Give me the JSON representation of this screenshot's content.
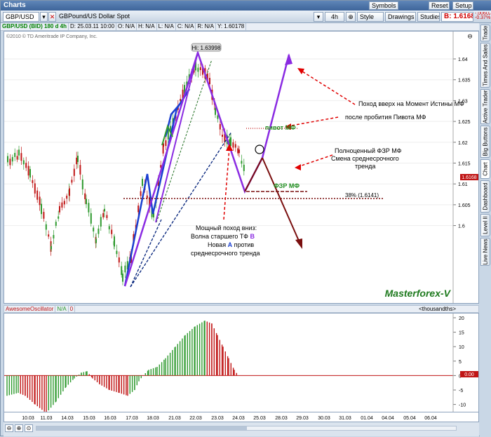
{
  "window": {
    "title": "Charts"
  },
  "toolbar": {
    "symbol": "GBP/USD",
    "description": "GBPound/US Dollar Spot",
    "timeframe": "4h",
    "style_label": "Style",
    "drawings_label": "Drawings",
    "studies_label": "Studies",
    "symbols_label": "Symbols",
    "reset_label": "Reset",
    "setup_label": "Setup",
    "bid_price": "B: 1.6168",
    "change_1": "-.00602",
    "change_2": "-0.37%"
  },
  "infobar": {
    "symbol_line": "GBP/USD (BID) 180 d 4h",
    "date": "D: 25.03.11 10:00",
    "open": "O: N/A",
    "high": "H: N/A",
    "low": "L: N/A",
    "close": "C: N/A",
    "range": "R: N/A",
    "y": "Y: 1.60178"
  },
  "chart": {
    "copyright": "©2010 © TD Ameritrade IP Company, Inc.",
    "hi_label": "Hi: 1.63998",
    "watermark": "Masterforex-V",
    "price_ticks": [
      "1.64",
      "1.635",
      "1.63",
      "1.625",
      "1.62",
      "1.615",
      "1.61",
      "1.605",
      "1.6"
    ],
    "price_values": [
      1.64,
      1.635,
      1.63,
      1.625,
      1.62,
      1.615,
      1.61,
      1.605,
      1.6
    ],
    "current_price_tag": "1.6168",
    "annotations": {
      "up_move": "Поход вверх на Момент Истины МФ",
      "after_pivot": "после пробития Пивота МФ",
      "pivot": "пивот МФ",
      "fzr_complete_1": "Полноценный ФЗР МФ",
      "fzr_complete_2": "Смена среднесрочного",
      "fzr_complete_3": "тренда",
      "fzr": "ФЗР МФ",
      "fib38": "38% (1.6141)",
      "down_1": "Мощный поход вниз:",
      "down_2a": "Волна старшего ТФ ",
      "down_2b": "B",
      "down_3a": "Новая ",
      "down_3b": "A",
      "down_3c": " против",
      "down_4": "среднесрочного тренда"
    }
  },
  "oscillator": {
    "name": "AwesomeOscillator",
    "val1": "N/A",
    "val2": "0",
    "units": "<thousandths>",
    "ticks": [
      "20",
      "15",
      "10",
      "5",
      "0",
      "-5",
      "-10"
    ],
    "tick_values": [
      20,
      15,
      10,
      5,
      0,
      -5,
      -10
    ],
    "current_tag": "0.00"
  },
  "dates": [
    "10.03",
    "11.03",
    "14.03",
    "15.03",
    "16.03",
    "17.03",
    "18.03",
    "21.03",
    "22.03",
    "23.03",
    "24.03",
    "25.03",
    "28.03",
    "29.03",
    "30.03",
    "31.03",
    "01.04",
    "04.04",
    "05.04",
    "06.04"
  ],
  "sidebar": [
    "Trade",
    "Times And Sales",
    "Active Trader",
    "Big Buttons",
    "Chart",
    "Dashboard",
    "Level II",
    "Live News"
  ],
  "colors": {
    "bull": "#2e9a2e",
    "bear": "#c01515",
    "purple": "#8a2be2",
    "blue": "#1a3fd1",
    "maroon": "#7a0f0f",
    "annot_red": "#e00000"
  }
}
